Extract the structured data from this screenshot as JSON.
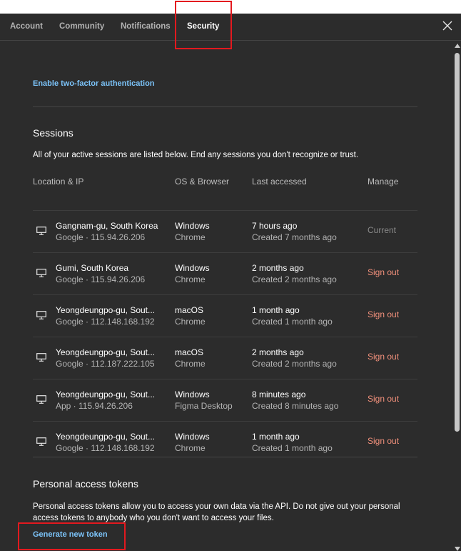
{
  "tabs": [
    {
      "label": "Account",
      "active": false
    },
    {
      "label": "Community",
      "active": false
    },
    {
      "label": "Notifications",
      "active": false
    },
    {
      "label": "Security",
      "active": true
    }
  ],
  "security": {
    "two_factor_link": "Enable two-factor authentication"
  },
  "sessions": {
    "title": "Sessions",
    "description": "All of your active sessions are listed below. End any sessions you don't recognize or trust.",
    "columns": [
      "Location & IP",
      "OS & Browser",
      "Last accessed",
      "Manage"
    ],
    "rows": [
      {
        "location": "Gangnam-gu, South Korea",
        "ip": "Google · 115.94.26.206",
        "os": "Windows",
        "browser": "Chrome",
        "last": "7 hours ago",
        "created": "Created 7 months ago",
        "manage": "Current"
      },
      {
        "location": "Gumi, South Korea",
        "ip": "Google · 115.94.26.206",
        "os": "Windows",
        "browser": "Chrome",
        "last": "2 months ago",
        "created": "Created 2 months ago",
        "manage": "Sign out"
      },
      {
        "location": "Yeongdeungpo-gu, Sout...",
        "ip": "Google · 112.148.168.192",
        "os": "macOS",
        "browser": "Chrome",
        "last": "1 month ago",
        "created": "Created 1 month ago",
        "manage": "Sign out"
      },
      {
        "location": "Yeongdeungpo-gu, Sout...",
        "ip": "Google · 112.187.222.105",
        "os": "macOS",
        "browser": "Chrome",
        "last": "2 months ago",
        "created": "Created 2 months ago",
        "manage": "Sign out"
      },
      {
        "location": "Yeongdeungpo-gu, Sout...",
        "ip": "App · 115.94.26.206",
        "os": "Windows",
        "browser": "Figma Desktop",
        "last": "8 minutes ago",
        "created": "Created 8 minutes ago",
        "manage": "Sign out"
      },
      {
        "location": "Yeongdeungpo-gu, Sout...",
        "ip": "Google · 112.148.168.192",
        "os": "Windows",
        "browser": "Chrome",
        "last": "1 month ago",
        "created": "Created 1 month ago",
        "manage": "Sign out"
      }
    ]
  },
  "tokens": {
    "title": "Personal access tokens",
    "description": "Personal access tokens allow you to access your own data via the API. Do not give out your personal access tokens to anybody who you don't want to access your files.",
    "generate_label": "Generate new token"
  },
  "colors": {
    "background": "#2c2c2c",
    "link": "#7cc4fa",
    "sign_out": "#f3917c",
    "annotation": "#e3191f"
  },
  "icons": {
    "close": "close-icon",
    "device": "desktop-icon"
  }
}
